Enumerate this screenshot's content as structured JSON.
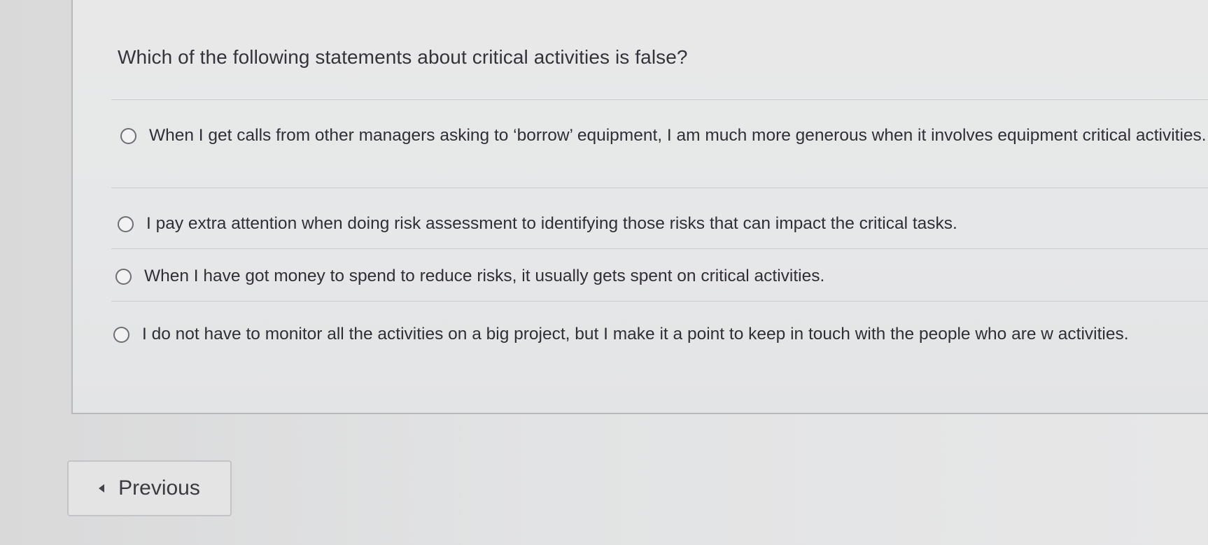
{
  "question": {
    "text": "Which of the following statements about critical activities is false?"
  },
  "options": [
    {
      "label": "When I get calls from other managers asking to ‘borrow’ equipment, I am much more generous when it involves equipment critical activities."
    },
    {
      "label": "I pay extra attention when doing risk assessment to identifying those risks that can impact the critical tasks."
    },
    {
      "label": "When I have got money to spend to reduce risks, it usually gets spent on critical activities."
    },
    {
      "label": "I do not have to monitor all the activities on a big project, but I make it a point to keep in touch with the people who are w activities."
    }
  ],
  "navigation": {
    "previous_label": "Previous",
    "previous_icon": "caret-left-icon"
  }
}
